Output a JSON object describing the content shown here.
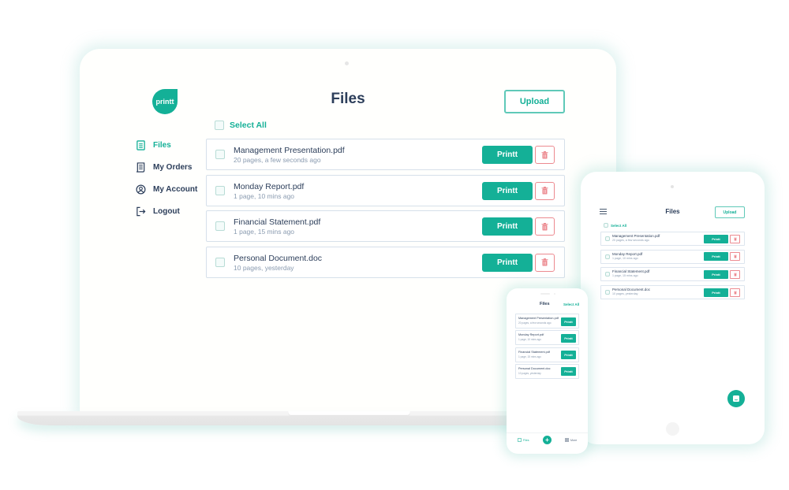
{
  "brand": {
    "logo_text": "printt",
    "accent": "#14b097",
    "danger": "#ec8a90",
    "text": "#2c3e5a"
  },
  "desktop": {
    "title": "Files",
    "upload_label": "Upload",
    "select_all_label": "Select All",
    "sidebar": [
      {
        "label": "Files",
        "icon": "document-icon",
        "active": true
      },
      {
        "label": "My Orders",
        "icon": "receipt-icon",
        "active": false
      },
      {
        "label": "My Account",
        "icon": "user-circle-icon",
        "active": false
      },
      {
        "label": "Logout",
        "icon": "logout-icon",
        "active": false
      }
    ],
    "print_label": "Printt",
    "files": [
      {
        "name": "Management Presentation.pdf",
        "meta": "20 pages, a few seconds ago"
      },
      {
        "name": "Monday Report.pdf",
        "meta": "1 page, 10 mins ago"
      },
      {
        "name": "Financial Statement.pdf",
        "meta": "1 page, 15 mins ago"
      },
      {
        "name": "Personal Document.doc",
        "meta": "10 pages, yesterday"
      }
    ]
  },
  "tablet": {
    "title": "Files",
    "upload_label": "Upload",
    "select_all_label": "Select All",
    "print_label": "Printt",
    "files": [
      {
        "name": "Management Presentation.pdf",
        "meta": "20 pages, a few seconds ago"
      },
      {
        "name": "Monday Report.pdf",
        "meta": "1 page, 10 mins ago"
      },
      {
        "name": "Financial Statement.pdf",
        "meta": "1 page, 15 mins ago"
      },
      {
        "name": "Personal Document.doc",
        "meta": "10 pages, yesterday"
      }
    ]
  },
  "phone": {
    "title": "Files",
    "select_all_label": "Select All",
    "print_label": "Printt",
    "files": [
      {
        "name": "Management Presentation.pdf",
        "meta": "20 pages, a few seconds ago"
      },
      {
        "name": "Monday Report.pdf",
        "meta": "1 page, 10 mins ago"
      },
      {
        "name": "Financial Statement.pdf",
        "meta": "1 page, 15 mins ago"
      },
      {
        "name": "Personal Document.doc",
        "meta": "10 pages, yesterday"
      }
    ],
    "nav": {
      "files_label": "Files",
      "fab_label": "+",
      "more_label": "More"
    }
  }
}
